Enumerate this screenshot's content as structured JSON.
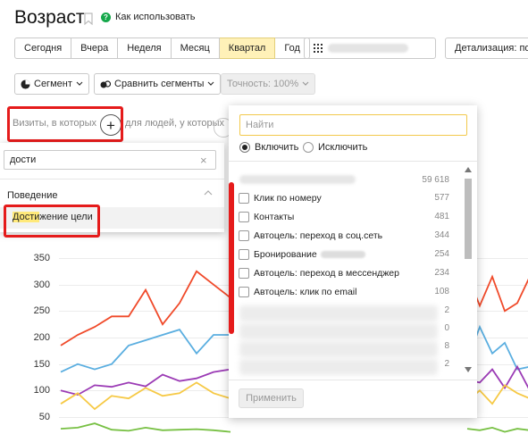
{
  "header": {
    "title": "Возраст",
    "howto_label": "Как использовать",
    "howto_icon_glyph": "?"
  },
  "period_tabs": [
    {
      "label": "Сегодня",
      "active": false
    },
    {
      "label": "Вчера",
      "active": false
    },
    {
      "label": "Неделя",
      "active": false
    },
    {
      "label": "Месяц",
      "active": false
    },
    {
      "label": "Квартал",
      "active": true
    },
    {
      "label": "Год",
      "active": false
    }
  ],
  "toolbar": {
    "detail_label": "Детализация: по",
    "segment_label": "Сегмент",
    "compare_label": "Сравнить сегменты",
    "accuracy_label": "Точность: 100%"
  },
  "condition": {
    "visits_label": "Визиты, в которых",
    "people_label": "для людей, у которых",
    "plus_glyph": "+"
  },
  "left_dropdown": {
    "search_value": "дости",
    "clear_glyph": "×",
    "group_label": "Поведение",
    "item_highlight": "Дости",
    "item_rest": "жение цели"
  },
  "filter_panel": {
    "find_placeholder": "Найти",
    "include_label": "Включить",
    "exclude_label": "Исключить",
    "first_value": "59 618",
    "rows": [
      {
        "label": "Клик по номеру",
        "value": "577"
      },
      {
        "label": "Контакты",
        "value": "481"
      },
      {
        "label": "Автоцель: переход в соц.сеть",
        "value": "344"
      },
      {
        "label": "Бронирование",
        "value": "254"
      },
      {
        "label": "Автоцель: переход в мессенджер",
        "value": "234"
      },
      {
        "label": "Автоцель: клик по email",
        "value": "108"
      }
    ],
    "blurred_values": [
      "2",
      "0",
      "8",
      "2"
    ],
    "apply_label": "Применить"
  },
  "chart_data": {
    "type": "line",
    "y_ticks": [
      "350",
      "300",
      "250",
      "200",
      "150",
      "100",
      "50"
    ],
    "colors": {
      "red": "#f04a2a",
      "blue": "#5aaee0",
      "purple": "#9b3bb5",
      "yellow": "#f6c945",
      "green": "#77c043"
    },
    "series": [
      {
        "color": "red",
        "values": [
          185,
          205,
          220,
          240,
          240,
          290,
          225,
          265,
          325,
          300,
          275
        ]
      },
      {
        "color": "blue",
        "values": [
          135,
          150,
          140,
          150,
          185,
          195,
          205,
          215,
          170,
          205,
          205
        ]
      },
      {
        "color": "purple",
        "values": [
          100,
          92,
          110,
          107,
          115,
          108,
          130,
          118,
          123,
          135,
          140
        ]
      },
      {
        "color": "yellow",
        "values": [
          75,
          95,
          65,
          90,
          85,
          105,
          90,
          95,
          115,
          95,
          85
        ]
      },
      {
        "color": "green",
        "values": [
          28,
          30,
          38,
          26,
          24,
          30,
          25,
          26,
          27,
          25,
          22
        ]
      }
    ],
    "right_series": [
      {
        "color": "red",
        "values": [
          320,
          260,
          315,
          250,
          265,
          315
        ]
      },
      {
        "color": "blue",
        "values": [
          155,
          220,
          170,
          190,
          140,
          145
        ]
      },
      {
        "color": "purple",
        "values": [
          120,
          115,
          140,
          105,
          145,
          100
        ]
      },
      {
        "color": "yellow",
        "values": [
          80,
          100,
          75,
          110,
          95,
          85
        ]
      },
      {
        "color": "green",
        "values": [
          28,
          25,
          30,
          22,
          28,
          25
        ]
      }
    ]
  }
}
